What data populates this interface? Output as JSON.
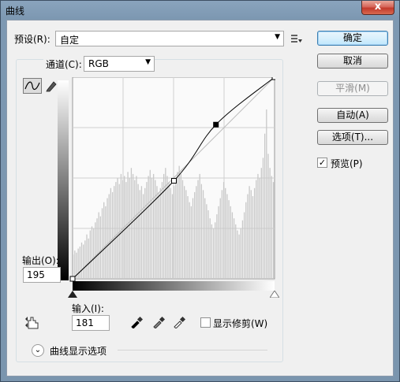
{
  "window": {
    "title": "曲线",
    "close_label": "x"
  },
  "preset": {
    "label": "预设(R):",
    "value": "自定",
    "menu_icon": "preset-options-icon"
  },
  "channel": {
    "label": "通道(C):",
    "value": "RGB"
  },
  "buttons": {
    "ok": "确定",
    "cancel": "取消",
    "smooth": "平滑(M)",
    "auto": "自动(A)",
    "options": "选项(T)..."
  },
  "preview": {
    "label": "预览(P)",
    "checked": true,
    "check_mark": "✓"
  },
  "output": {
    "label": "输出(O):",
    "value": "195"
  },
  "input": {
    "label": "输入(I):",
    "value": "181"
  },
  "show_clipping": {
    "label": "显示修剪(W)",
    "checked": false
  },
  "curve_display_options": {
    "label": "曲线显示选项",
    "expanded": false,
    "toggle_glyph": "⌄"
  },
  "tools": [
    "curve-point-tool-icon",
    "pencil-draw-tool-icon",
    "on-image-adjust-tool-icon",
    "black-point-eyedropper-icon",
    "gray-point-eyedropper-icon",
    "white-point-eyedropper-icon"
  ],
  "curve": {
    "points": [
      [
        0,
        0
      ],
      [
        128,
        124
      ],
      [
        181,
        195
      ],
      [
        255,
        255
      ]
    ],
    "selected_point": [
      181,
      195
    ],
    "range": [
      0,
      255
    ]
  },
  "histogram": [
    12,
    14,
    13,
    15,
    16,
    18,
    17,
    19,
    22,
    20,
    24,
    26,
    25,
    28,
    30,
    33,
    31,
    35,
    38,
    36,
    40,
    42,
    45,
    43,
    46,
    48,
    50,
    47,
    52,
    49,
    51,
    48,
    53,
    50,
    55,
    52,
    49,
    51,
    47,
    44,
    46,
    42,
    45,
    48,
    51,
    54,
    50,
    52,
    49,
    46,
    43,
    45,
    48,
    52,
    55,
    51,
    48,
    45,
    42,
    46,
    50,
    53,
    56,
    52,
    49,
    46,
    44,
    41,
    38,
    36,
    40,
    43,
    46,
    49,
    52,
    47,
    44,
    40,
    37,
    34,
    30,
    27,
    25,
    28,
    32,
    36,
    40,
    44,
    48,
    45,
    42,
    39,
    36,
    33,
    30,
    27,
    24,
    22,
    25,
    29,
    33,
    38,
    42,
    46,
    44,
    41,
    45,
    49,
    52,
    50,
    55,
    60,
    72,
    84,
    62,
    55,
    51,
    48
  ]
}
